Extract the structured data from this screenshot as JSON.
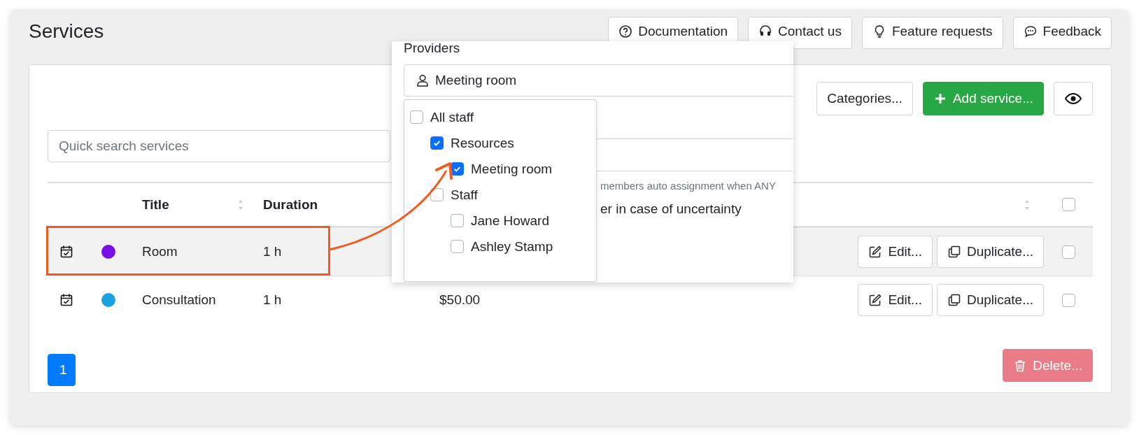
{
  "page": {
    "title": "Services"
  },
  "header_buttons": [
    {
      "label": "Documentation",
      "kind": "help"
    },
    {
      "label": "Contact us",
      "kind": "headset"
    },
    {
      "label": "Feature requests",
      "kind": "bulb"
    },
    {
      "label": "Feedback",
      "kind": "chat"
    }
  ],
  "toolbar": {
    "categories_button": "Categories...",
    "add_button": "Add service..."
  },
  "search": {
    "placeholder": "Quick search services"
  },
  "table": {
    "columns": [
      "Title",
      "Duration"
    ],
    "select_all": {
      "checked": false
    },
    "rows": [
      {
        "title": "Room",
        "duration": "1 h",
        "color": "#7b0ee6",
        "highlighted": true,
        "checked": false,
        "actions": [
          "Edit...",
          "Duplicate..."
        ]
      },
      {
        "title": "Consultation",
        "duration": "1 h",
        "price": "$50.00",
        "color": "#1ba1e2",
        "highlighted": false,
        "checked": false,
        "actions": [
          "Edit...",
          "Duplicate..."
        ]
      }
    ]
  },
  "pagination": [
    {
      "label": "1",
      "selected": true
    }
  ],
  "delete_button": "Delete...",
  "providers_popover": {
    "label": "Providers",
    "value": "Meeting room",
    "hint": "members auto assignment when ANY",
    "note": "er in case of uncertainty",
    "tree": [
      {
        "label": "All staff",
        "checked": false,
        "children": [
          {
            "label": "Resources",
            "checked": true,
            "children": [
              {
                "label": "Meeting room",
                "checked": true
              }
            ]
          },
          {
            "label": "Staff",
            "checked": false,
            "children": [
              {
                "label": "Jane Howard",
                "checked": false
              },
              {
                "label": "Ashley Stamp",
                "checked": false
              }
            ]
          }
        ]
      }
    ]
  }
}
